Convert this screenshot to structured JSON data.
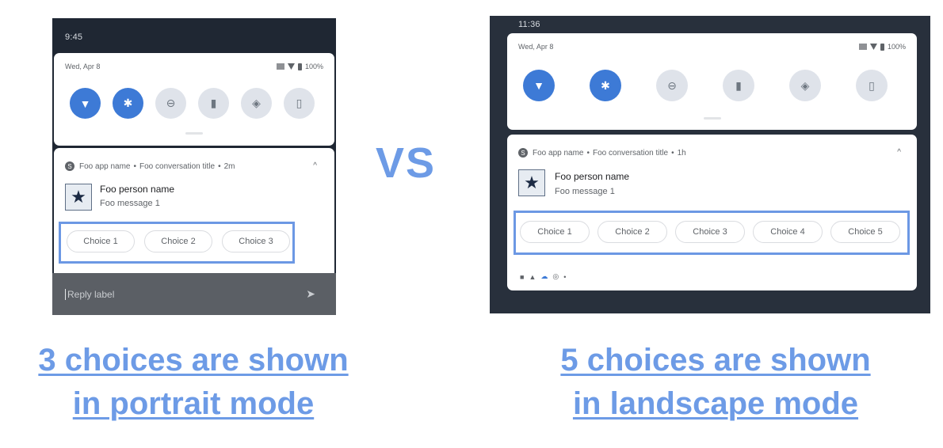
{
  "vs_label": "VS",
  "portrait": {
    "status_time": "9:45",
    "quick_settings": {
      "date": "Wed, Apr 8",
      "battery": "100%",
      "tiles": [
        {
          "name": "wifi",
          "icon": "wifi-icon",
          "glyph": "▼",
          "active": true
        },
        {
          "name": "bluetooth",
          "icon": "bluetooth-icon",
          "glyph": "✱",
          "active": true
        },
        {
          "name": "do-not-disturb",
          "icon": "do-not-disturb-icon",
          "glyph": "⊖",
          "active": false
        },
        {
          "name": "flashlight",
          "icon": "flashlight-icon",
          "glyph": "▮",
          "active": false
        },
        {
          "name": "auto-rotate",
          "icon": "rotate-icon",
          "glyph": "◈",
          "active": false
        },
        {
          "name": "battery-saver",
          "icon": "battery-saver-icon",
          "glyph": "▯",
          "active": false
        }
      ]
    },
    "notification": {
      "app_name": "Foo app name",
      "conversation_title": "Foo conversation title",
      "time": "2m",
      "person_name": "Foo person name",
      "message": "Foo message 1",
      "choices": [
        "Choice 1",
        "Choice 2",
        "Choice 3"
      ]
    },
    "reply_placeholder": "Reply label"
  },
  "landscape": {
    "status_time": "11:36",
    "quick_settings": {
      "date": "Wed, Apr 8",
      "battery": "100%",
      "tiles": [
        {
          "name": "wifi",
          "icon": "wifi-icon",
          "glyph": "▼",
          "active": true
        },
        {
          "name": "bluetooth",
          "icon": "bluetooth-icon",
          "glyph": "✱",
          "active": true
        },
        {
          "name": "do-not-disturb",
          "icon": "do-not-disturb-icon",
          "glyph": "⊖",
          "active": false
        },
        {
          "name": "flashlight",
          "icon": "flashlight-icon",
          "glyph": "▮",
          "active": false
        },
        {
          "name": "auto-rotate",
          "icon": "rotate-icon",
          "glyph": "◈",
          "active": false
        },
        {
          "name": "battery-saver",
          "icon": "battery-saver-icon",
          "glyph": "▯",
          "active": false
        }
      ]
    },
    "notification": {
      "app_name": "Foo app name",
      "conversation_title": "Foo conversation title",
      "time": "1h",
      "person_name": "Foo person name",
      "message": "Foo message 1",
      "choices": [
        "Choice 1",
        "Choice 2",
        "Choice 3",
        "Choice 4",
        "Choice 5"
      ]
    }
  },
  "captions": {
    "portrait_line1": "3 choices are shown",
    "portrait_line2": "in portrait mode",
    "landscape_line1": "5 choices are shown",
    "landscape_line2": "in landscape mode"
  },
  "colors": {
    "accent": "#6d9be6",
    "tile_active": "#3d7ad6",
    "tile_inactive": "#dfe3ea",
    "phone_background": "#1f2733"
  }
}
